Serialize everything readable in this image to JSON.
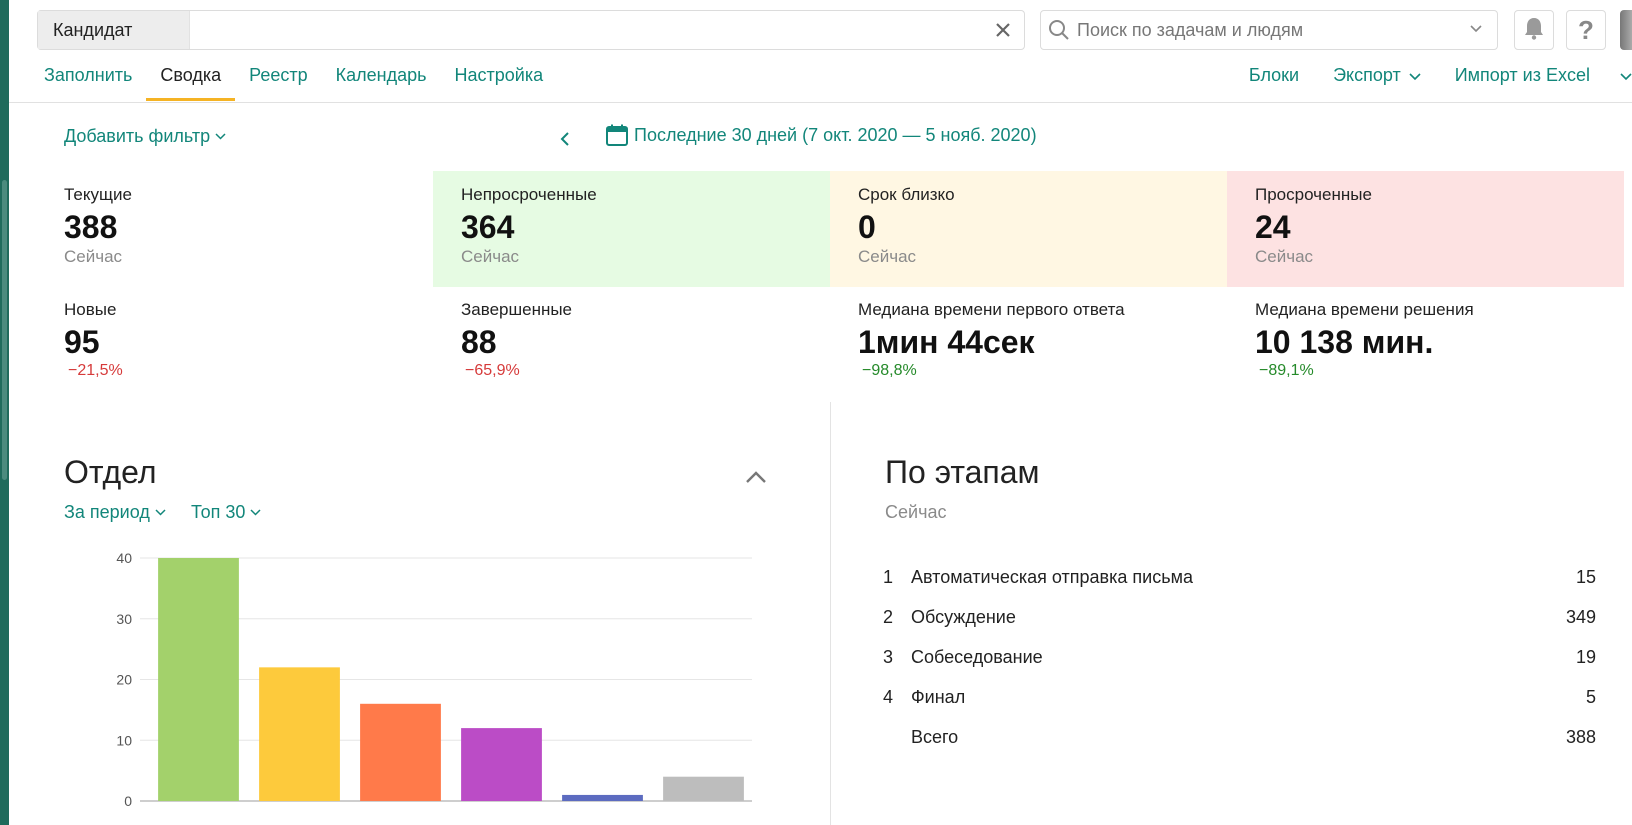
{
  "topbar": {
    "candidate_chip": "Кандидат",
    "search_placeholder": "Поиск по задачам и людям"
  },
  "nav": {
    "tabs": [
      {
        "label": "Заполнить",
        "active": false
      },
      {
        "label": "Сводка",
        "active": true
      },
      {
        "label": "Реестр",
        "active": false
      },
      {
        "label": "Календарь",
        "active": false
      },
      {
        "label": "Настройка",
        "active": false
      }
    ],
    "right": {
      "blocks": "Блоки",
      "export": "Экспорт",
      "import": "Импорт из Excel"
    }
  },
  "filter": {
    "add_filter": "Добавить фильтр",
    "period": "Последние 30 дней (7 окт. 2020 — 5 нояб. 2020)"
  },
  "stats": {
    "current": {
      "label": "Текущие",
      "value": "388",
      "sub": "Сейчас"
    },
    "not_overdue": {
      "label": "Непросроченные",
      "value": "364",
      "sub": "Сейчас"
    },
    "due_soon": {
      "label": "Срок близко",
      "value": "0",
      "sub": "Сейчас"
    },
    "overdue": {
      "label": "Просроченные",
      "value": "24",
      "sub": "Сейчас"
    },
    "new": {
      "label": "Новые",
      "value": "95",
      "delta": "−21,5%"
    },
    "completed": {
      "label": "Завершенные",
      "value": "88",
      "delta": "−65,9%"
    },
    "first_response": {
      "label": "Медиана времени первого ответа",
      "value": "1мин 44сек",
      "delta": "−98,8%"
    },
    "resolution": {
      "label": "Медиана времени решения",
      "value": "10 138 мин.",
      "delta": "−89,1%"
    }
  },
  "department": {
    "title": "Отдел",
    "filter_period": "За период",
    "filter_top": "Топ 30"
  },
  "chart_data": {
    "type": "bar",
    "title": "Отдел",
    "xlabel": "",
    "ylabel": "",
    "ylim": [
      0,
      40
    ],
    "yticks": [
      "0",
      "10",
      "20",
      "30",
      "40"
    ],
    "values": [
      40,
      22,
      16,
      12,
      1,
      4
    ],
    "colors": [
      "#a3d16b",
      "#fdca3c",
      "#ff7a4a",
      "#bb4cc6",
      "#5c6bc0",
      "#bdbdbd"
    ],
    "grid": true
  },
  "stages": {
    "title": "По этапам",
    "sub": "Сейчас",
    "rows": [
      {
        "num": "1",
        "name": "Автоматическая отправка письма",
        "count": "15"
      },
      {
        "num": "2",
        "name": "Обсуждение",
        "count": "349"
      },
      {
        "num": "3",
        "name": "Собеседование",
        "count": "19"
      },
      {
        "num": "4",
        "name": "Финал",
        "count": "5"
      },
      {
        "num": "",
        "name": "Всего",
        "count": "388"
      }
    ]
  }
}
